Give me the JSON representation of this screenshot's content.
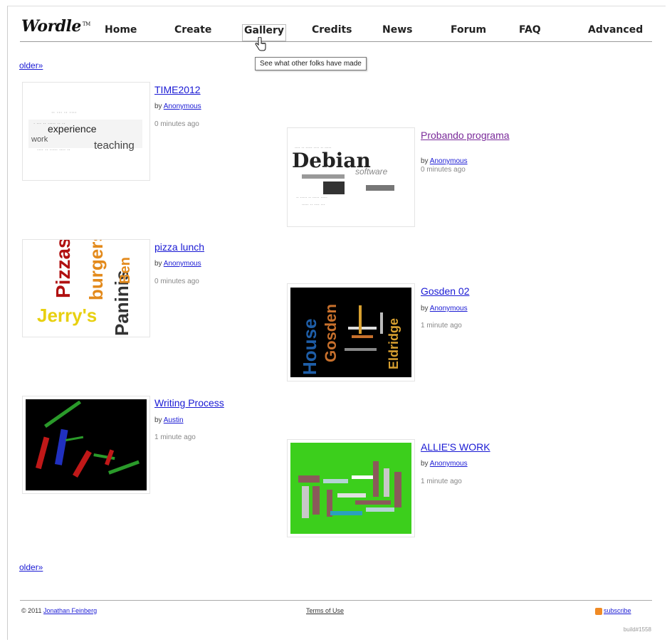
{
  "logo": {
    "text": "Wordle",
    "tm": "TM"
  },
  "nav": {
    "items": [
      {
        "label": "Home"
      },
      {
        "label": "Create"
      },
      {
        "label": "Gallery"
      },
      {
        "label": "Credits"
      },
      {
        "label": "News"
      },
      {
        "label": "Forum"
      },
      {
        "label": "FAQ"
      },
      {
        "label": "Advanced"
      }
    ]
  },
  "tooltip": "See what other folks have made",
  "older_label": "older»",
  "entries": [
    {
      "title": "TIME2012",
      "by": "by",
      "author": "Anonymous",
      "time": "0 minutes ago"
    },
    {
      "title": "Probando programa",
      "by": "by",
      "author": "Anonymous",
      "time": "0 minutes ago"
    },
    {
      "title": "pizza lunch",
      "by": "by",
      "author": "Anonymous",
      "time": "0 minutes ago"
    },
    {
      "title": "Gosden 02",
      "by": "by",
      "author": "Anonymous",
      "time": "1 minute ago"
    },
    {
      "title": "Writing Process",
      "by": "by",
      "author": "Austin",
      "time": "1 minute ago"
    },
    {
      "title": "ALLIE'S WORK",
      "by": "by",
      "author": "Anonymous",
      "time": "1 minute ago"
    }
  ],
  "thumb_words": {
    "time2012": [
      "experience",
      "work",
      "teaching"
    ],
    "debian": [
      "Debian",
      "software"
    ],
    "pizza": [
      "Pizzas",
      "burgers",
      "Paninis",
      "Ben",
      "Jerry's"
    ],
    "gosden": [
      "House",
      "Gosden",
      "Eldridge"
    ]
  },
  "colors": {
    "link": "#1a1ad4",
    "visited": "#7a2a9a",
    "allie_bg": "#3ccf1c"
  },
  "footer": {
    "copyright": "© 2011",
    "owner": "Jonathan Feinberg",
    "terms": "Terms of Use",
    "subscribe": "subscribe",
    "build": "build#1558"
  }
}
